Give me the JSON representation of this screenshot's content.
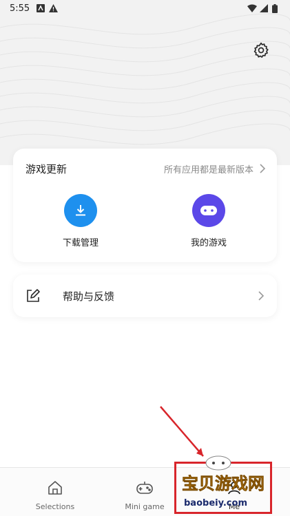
{
  "status_bar": {
    "time": "5:55",
    "left_icons": [
      "a-box-icon",
      "warning-icon"
    ],
    "right_icons": [
      "wifi-icon",
      "signal-icon",
      "battery-icon"
    ]
  },
  "header": {
    "settings_icon": "gear-icon"
  },
  "updates_card": {
    "title": "游戏更新",
    "status": "所有应用都是最新版本",
    "quick_actions": [
      {
        "label": "下载管理",
        "icon": "download-icon",
        "color": "#1e90ee"
      },
      {
        "label": "我的游戏",
        "icon": "gamepad-icon",
        "color": "#5b48e8"
      }
    ]
  },
  "help_card": {
    "label": "帮助与反馈",
    "icon": "edit-icon"
  },
  "bottom_nav": {
    "items": [
      {
        "label": "Selections",
        "icon": "home-icon"
      },
      {
        "label": "Mini game",
        "icon": "gamepad-icon"
      },
      {
        "label": "Me",
        "icon": "person-icon"
      }
    ]
  },
  "watermark": {
    "title": "宝贝游戏网",
    "url": "baobeiy.com",
    "colors": {
      "box": "#d8252b",
      "title": "#f5a623"
    }
  }
}
